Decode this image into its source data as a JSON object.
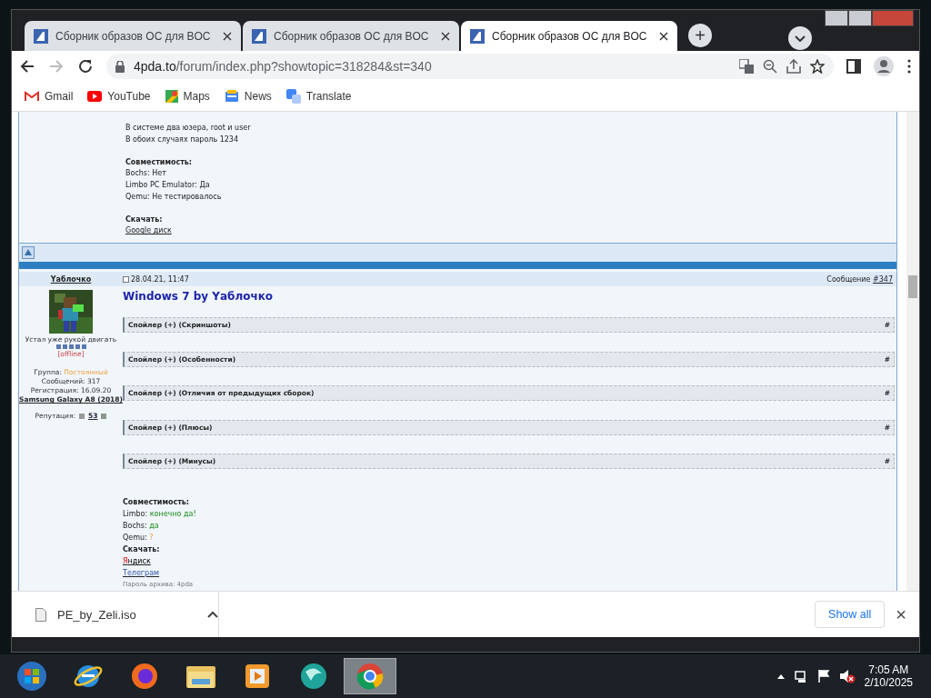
{
  "browser": {
    "tabs": [
      {
        "title": "Сборник образов ОС для BOC",
        "selected": false
      },
      {
        "title": "Сборник образов ОС для BOC",
        "selected": false
      },
      {
        "title": "Сборник образов ОС для BOC",
        "selected": true
      }
    ],
    "new_tab": "+",
    "address": {
      "domain": "4pda.to",
      "path": "/forum/index.php?showtopic=318284&st=340"
    },
    "bookmarks": [
      {
        "kind": "gmail",
        "label": "Gmail"
      },
      {
        "kind": "youtube",
        "label": "YouTube"
      },
      {
        "kind": "maps",
        "label": "Maps"
      },
      {
        "kind": "news",
        "label": "News"
      },
      {
        "kind": "translate",
        "label": "Translate"
      }
    ]
  },
  "previous_post": {
    "lines": [
      {
        "kind": "text",
        "text": "В системе два юзера, root и user"
      },
      {
        "kind": "text",
        "text": "В обоих случаях пароль 1234"
      },
      {
        "kind": "gap"
      },
      {
        "kind": "heading",
        "text": "Совместимость:"
      },
      {
        "kind": "text",
        "text": "Bochs: Нет"
      },
      {
        "kind": "text",
        "text": "Limbo PC Emulator: Да"
      },
      {
        "kind": "text",
        "text": "Qemu: Не тестировалось"
      },
      {
        "kind": "gap"
      },
      {
        "kind": "heading",
        "text": "Скачать:"
      },
      {
        "kind": "link",
        "text": "Google диск"
      }
    ]
  },
  "post": {
    "author": "Yаблочко",
    "date": "28.04.21, 11:47",
    "message_label": "Сообщение",
    "message_number": "#347",
    "title": "Windows 7 by Yаблочко",
    "user": {
      "status": "Устал уже рукой двигать",
      "online": "[offline]",
      "group_label": "Группа:",
      "group": "Постоянный",
      "messages": "Сообщений: 317",
      "registered": "Регистрация: 16.09.20",
      "device": "Samsung Galaxy A8 (2018)",
      "reputation_label": "Репутация:",
      "reputation": "53"
    },
    "spoilers": [
      {
        "label": "Спойлер (+) (Скриншоты)",
        "anchor": "#"
      },
      {
        "label": "Спойлер (+) (Особенности)",
        "anchor": "#"
      },
      {
        "label": "Спойлер (+) (Отличия от предыдущих сборок)",
        "anchor": "#"
      },
      {
        "label": "Спойлер (+) (Плюсы)",
        "anchor": "#"
      },
      {
        "label": "Спойлер (+) (Минусы)",
        "anchor": "#"
      }
    ],
    "body": [
      {
        "kind": "heading",
        "text": "Совместимость:"
      },
      {
        "kind": "yes",
        "label": "Limbo:",
        "value": "конечно да!"
      },
      {
        "kind": "yes",
        "label": "Bochs:",
        "value": "да"
      },
      {
        "kind": "unknown",
        "label": "Qemu:",
        "value": "?"
      },
      {
        "kind": "heading",
        "text": "Скачать:"
      },
      {
        "kind": "link",
        "parts": [
          {
            "kind": "brand",
            "text": "Я"
          },
          {
            "kind": "plain",
            "text": "ндиск"
          }
        ]
      },
      {
        "kind": "link",
        "parts": [
          {
            "kind": "link",
            "text": "Телеграм"
          }
        ]
      },
      {
        "kind": "note",
        "text": "Пароль архива: 4pda"
      }
    ]
  },
  "downloads": {
    "file": "PE_by_Zeli.iso",
    "show_all": "Show all",
    "close": "×"
  },
  "taskbar": {
    "apps": [
      {
        "kind": "ie",
        "selected": false
      },
      {
        "kind": "firefox",
        "selected": false
      },
      {
        "kind": "explorer",
        "selected": false
      },
      {
        "kind": "media",
        "selected": false
      },
      {
        "kind": "globe",
        "selected": false
      },
      {
        "kind": "chrome",
        "selected": true
      }
    ],
    "time": "7:05 AM",
    "date": "2/10/2025"
  }
}
